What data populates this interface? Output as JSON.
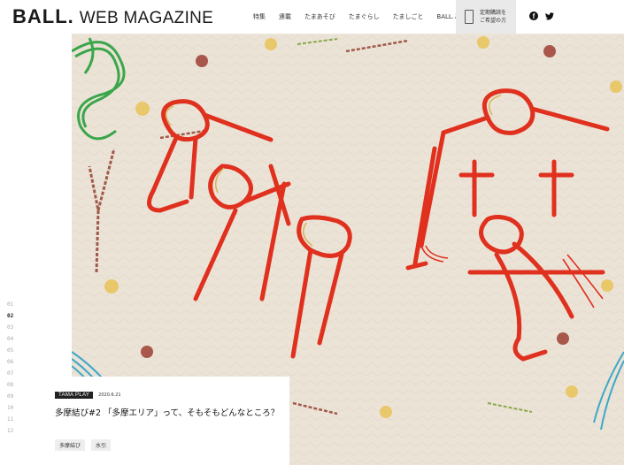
{
  "header": {
    "logo_main": "BALL.",
    "logo_sub": "WEB MAGAZINE",
    "nav": [
      "特集",
      "連載",
      "たまあそび",
      "たまぐらし",
      "たましごと",
      "BALL.とは"
    ],
    "cta_line1": "定期購読を",
    "cta_line2": "ご希望の方",
    "facebook_icon": "facebook-icon",
    "twitter_icon": "twitter-icon"
  },
  "hero": {
    "image": "red mizuhiki cord letters on beige washi paper"
  },
  "pager": {
    "items": [
      "01",
      "02",
      "03",
      "04",
      "05",
      "06",
      "07",
      "08",
      "09",
      "10",
      "11",
      "12"
    ],
    "active": "02"
  },
  "article": {
    "category": "TAMA PLAY",
    "date": "2020.6.21",
    "title": "多摩結び#2 「多摩エリア」って、そもそもどんなところ？",
    "tags": [
      "多摩結び",
      "水引"
    ]
  },
  "colors": {
    "accent_red": "#e0301e",
    "badge": "#222222",
    "background": "#ece3d7"
  }
}
